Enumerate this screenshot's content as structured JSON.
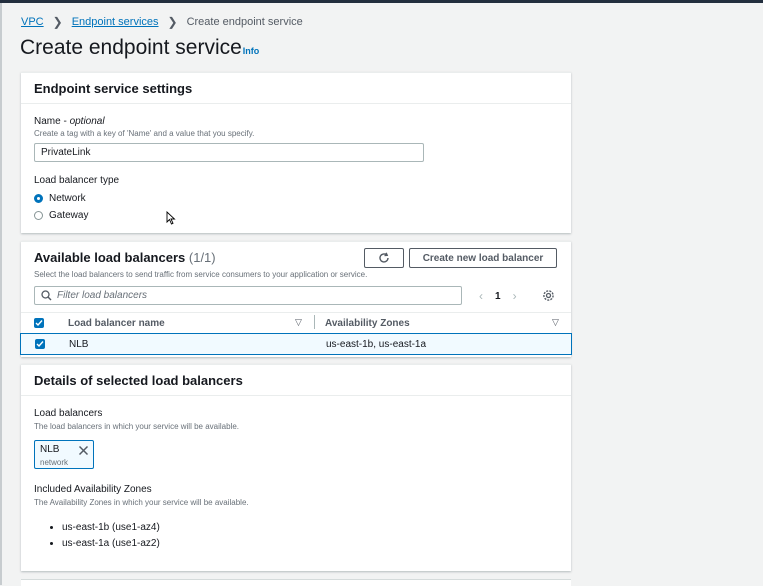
{
  "breadcrumb": {
    "vpc": "VPC",
    "endpoint_services": "Endpoint services",
    "current": "Create endpoint service"
  },
  "page": {
    "title": "Create endpoint service",
    "info": "Info"
  },
  "settings": {
    "heading": "Endpoint service settings",
    "name_label": "Name - ",
    "name_optional": "optional",
    "name_desc": "Create a tag with a key of 'Name' and a value that you specify.",
    "name_value": "PrivateLink",
    "lb_type_label": "Load balancer type",
    "options": [
      "Network",
      "Gateway"
    ],
    "selected": "Network"
  },
  "available": {
    "heading": "Available load balancers",
    "count": "(1/1)",
    "desc": "Select the load balancers to send traffic from service consumers to your application or service.",
    "create_button": "Create new load balancer",
    "filter_placeholder": "Filter load balancers",
    "page": "1",
    "columns": [
      "Load balancer name",
      "Availability Zones"
    ],
    "rows": [
      {
        "name": "NLB",
        "zones": "us-east-1b, us-east-1a",
        "selected": true
      }
    ]
  },
  "details": {
    "heading": "Details of selected load balancers",
    "lb_label": "Load balancers",
    "lb_desc": "The load balancers in which your service will be available.",
    "token_name": "NLB",
    "token_type": "network",
    "az_label": "Included Availability Zones",
    "az_desc": "The Availability Zones in which your service will be available.",
    "zones": [
      "us-east-1b (use1-az4)",
      "us-east-1a (use1-az2)"
    ]
  },
  "colors": {
    "accent": "#0073bb",
    "selected_row_bg": "#f1faff",
    "page_bg": "#f2f3f3"
  }
}
